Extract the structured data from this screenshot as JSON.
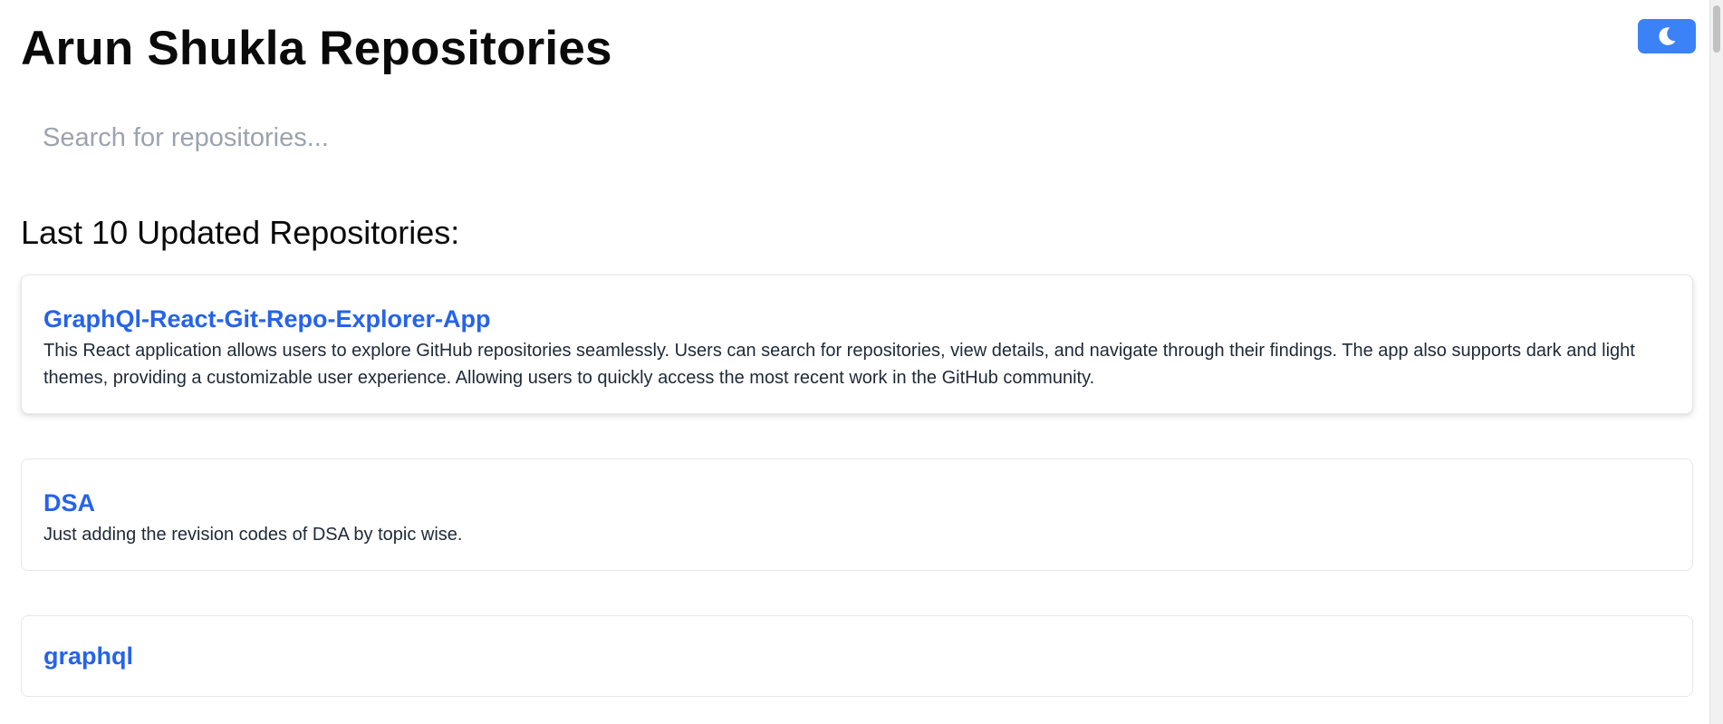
{
  "header": {
    "title": "Arun Shukla Repositories",
    "theme_toggle_icon": "moon-icon"
  },
  "search": {
    "placeholder": "Search for repositories...",
    "value": ""
  },
  "section": {
    "heading": "Last 10 Updated Repositories:"
  },
  "repositories": [
    {
      "name": "GraphQl-React-Git-Repo-Explorer-App",
      "description": "This React application allows users to explore GitHub repositories seamlessly. Users can search for repositories, view details, and navigate through their findings. The app also supports dark and light themes, providing a customizable user experience. Allowing users to quickly access the most recent work in the GitHub community."
    },
    {
      "name": "DSA",
      "description": "Just adding the revision codes of DSA by topic wise."
    },
    {
      "name": "graphql",
      "description": ""
    }
  ],
  "colors": {
    "accent": "#3b82f6",
    "link": "#2563eb",
    "placeholder": "#9ca3af"
  }
}
